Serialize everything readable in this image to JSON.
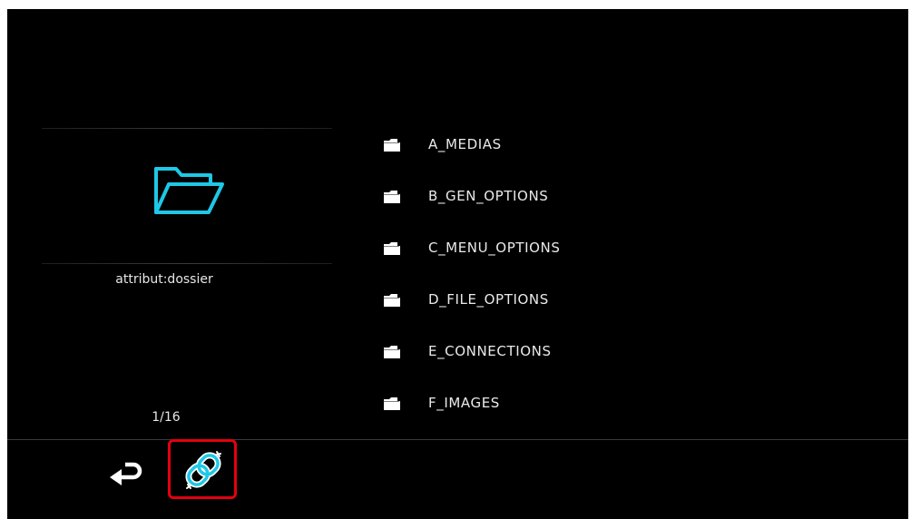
{
  "left_panel": {
    "icon": "folder-open-icon",
    "attribute": "attribut:dossier",
    "page_counter": "1/16"
  },
  "file_list": {
    "items": [
      {
        "label": "A_MEDIAS",
        "icon": "folder-icon"
      },
      {
        "label": "B_GEN_OPTIONS",
        "icon": "folder-icon"
      },
      {
        "label": "C_MENU_OPTIONS",
        "icon": "folder-icon"
      },
      {
        "label": "D_FILE_OPTIONS",
        "icon": "folder-icon"
      },
      {
        "label": "E_CONNECTIONS",
        "icon": "folder-icon"
      },
      {
        "label": "F_IMAGES",
        "icon": "folder-icon"
      }
    ]
  },
  "bottom_bar": {
    "buttons": [
      {
        "icon": "back-arrow-icon"
      },
      {
        "icon": "link-chain-icon",
        "highlighted": true
      }
    ]
  },
  "colors": {
    "background": "#000000",
    "text": "#eaeaea",
    "accent_cyan": "#1ec8e6",
    "highlight_red": "#e4000f"
  }
}
